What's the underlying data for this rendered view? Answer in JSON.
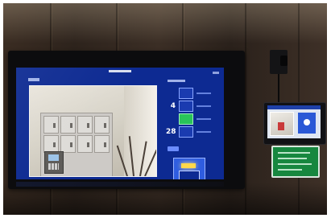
{
  "scene": {
    "subject": "",
    "colors": {
      "wall": "#33271f",
      "screen_bg": "#0d2a92",
      "locker": "#dedcd8",
      "sign_green": "#17873f",
      "indicator_green": "#29c45a"
    }
  },
  "monitor": {
    "right_panel": {
      "rows": [
        {
          "label": "",
          "state": "default"
        },
        {
          "label": "4",
          "state": "default"
        },
        {
          "label": "",
          "state": "active"
        },
        {
          "label": "28",
          "state": "default"
        }
      ]
    }
  },
  "tablet": {},
  "sign": {}
}
